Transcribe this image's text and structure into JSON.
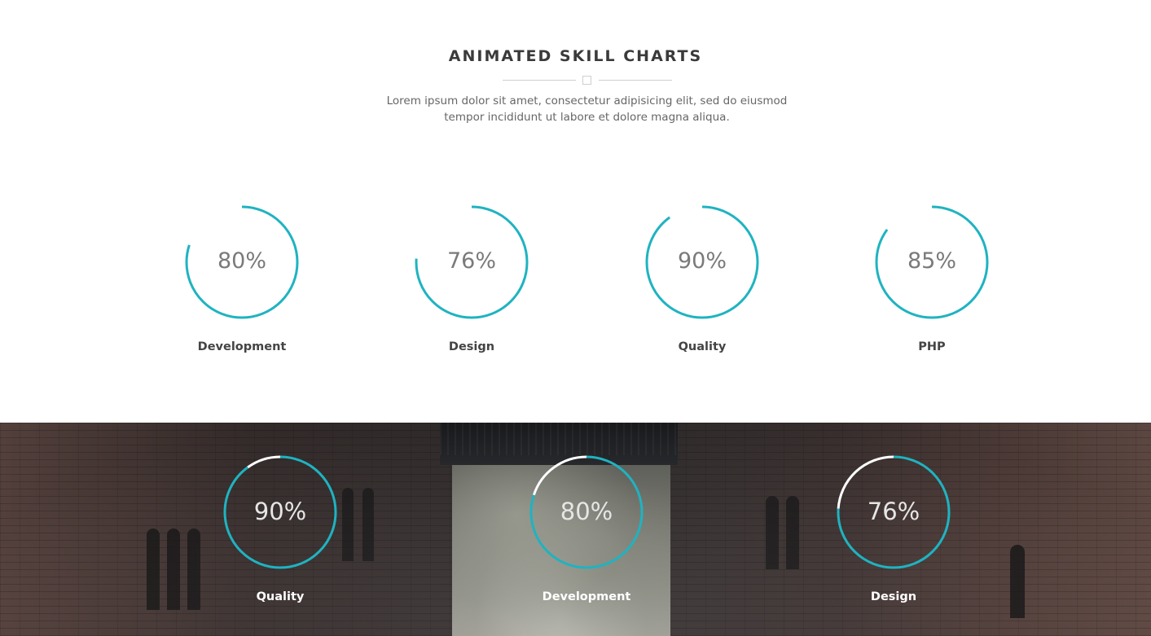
{
  "header": {
    "title": "ANIMATED SKILL CHARTS",
    "subtitle_line1": "Lorem ipsum dolor sit amet, consectetur adipisicing elit, sed do eiusmod",
    "subtitle_line2": "tempor incididunt ut labore et dolore magna aliqua."
  },
  "colors": {
    "accent": "#1fb3c1",
    "ring_track_dark": "#ffffff"
  },
  "light_skills": [
    {
      "label": "Development",
      "percent_text": "80%",
      "value": 80
    },
    {
      "label": "Design",
      "percent_text": "76%",
      "value": 76
    },
    {
      "label": "Quality",
      "percent_text": "90%",
      "value": 90
    },
    {
      "label": "PHP",
      "percent_text": "85%",
      "value": 85
    }
  ],
  "dark_skills": [
    {
      "label": "Quality",
      "percent_text": "90%",
      "value": 90
    },
    {
      "label": "Development",
      "percent_text": "80%",
      "value": 80
    },
    {
      "label": "Design",
      "percent_text": "76%",
      "value": 76
    }
  ]
}
